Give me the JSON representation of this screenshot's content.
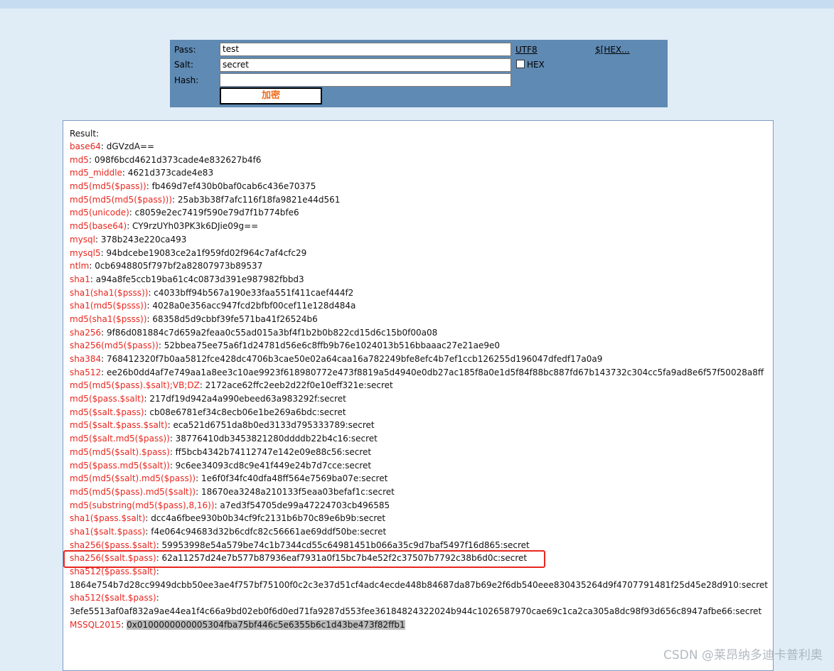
{
  "form": {
    "pass_label": "Pass:",
    "pass_value": "test",
    "salt_label": "Salt:",
    "salt_value": "secret",
    "hash_label": "Hash:",
    "hash_value": "",
    "utf8_link": "UTF8",
    "hex_link": "$[HEX...",
    "hex_checkbox_label": "HEX",
    "hex_checked": false,
    "encrypt_button": "加密"
  },
  "result": {
    "title": "Result:",
    "rows": [
      {
        "key": "base64",
        "value": "dGVzdA=="
      },
      {
        "key": "md5",
        "value": "098f6bcd4621d373cade4e832627b4f6"
      },
      {
        "key": "md5_middle",
        "value": "4621d373cade4e83"
      },
      {
        "key": "md5(md5($pass))",
        "value": "fb469d7ef430b0baf0cab6c436e70375"
      },
      {
        "key": "md5(md5(md5($pass)))",
        "value": "25ab3b38f7afc116f18fa9821e44d561"
      },
      {
        "key": "md5(unicode)",
        "value": "c8059e2ec7419f590e79d7f1b774bfe6"
      },
      {
        "key": "md5(base64)",
        "value": "CY9rzUYh03PK3k6DJie09g=="
      },
      {
        "key": "mysql",
        "value": "378b243e220ca493"
      },
      {
        "key": "mysql5",
        "value": "94bdcebe19083ce2a1f959fd02f964c7af4cfc29"
      },
      {
        "key": "ntlm",
        "value": "0cb6948805f797bf2a82807973b89537"
      },
      {
        "key": "sha1",
        "value": "a94a8fe5ccb19ba61c4c0873d391e987982fbbd3"
      },
      {
        "key": "sha1(sha1($psss))",
        "value": "c4033bff94b567a190e33faa551f411caef444f2"
      },
      {
        "key": "sha1(md5($psss))",
        "value": "4028a0e356acc947fcd2bfbf00cef11e128d484a"
      },
      {
        "key": "md5(sha1($psss))",
        "value": "68358d5d9cbbf39fe571ba41f26524b6"
      },
      {
        "key": "sha256",
        "value": "9f86d081884c7d659a2feaa0c55ad015a3bf4f1b2b0b822cd15d6c15b0f00a08"
      },
      {
        "key": "sha256(md5($pass))",
        "value": "52bbea75ee75a6f1d24781d56e6c8ffb9b76e1024013b516bbaaac27e21ae9e0"
      },
      {
        "key": "sha384",
        "value": "768412320f7b0aa5812fce428dc4706b3cae50e02a64caa16a782249bfe8efc4b7ef1ccb126255d196047dfedf17a0a9"
      },
      {
        "key": "sha512",
        "value": "ee26b0dd4af7e749aa1a8ee3c10ae9923f618980772e473f8819a5d4940e0db27ac185f8a0e1d5f84f88bc887fd67b143732c304cc5fa9ad8e6f57f50028a8ff"
      },
      {
        "key": "md5(md5($pass).$salt);VB;DZ",
        "value": "2172ace62ffc2eeb2d22f0e10eff321e:secret"
      },
      {
        "key": "md5($pass.$salt)",
        "value": "217df19d942a4a990ebeed63a983292f:secret"
      },
      {
        "key": "md5($salt.$pass)",
        "value": "cb08e6781ef34c8ecb06e1be269a6bdc:secret"
      },
      {
        "key": "md5($salt.$pass.$salt)",
        "value": "eca521d6751da8b0ed3133d795333789:secret"
      },
      {
        "key": "md5($salt.md5($pass))",
        "value": "38776410db3453821280ddddb22b4c16:secret"
      },
      {
        "key": "md5(md5($salt).$pass)",
        "value": "ff5bcb4342b74112747e142e09e88c56:secret"
      },
      {
        "key": "md5($pass.md5($salt))",
        "value": "9c6ee34093cd8c9e41f449e24b7d7cce:secret"
      },
      {
        "key": "md5(md5($salt).md5($pass))",
        "value": "1e6f0f34fc40dfa48ff564e7569ba07e:secret"
      },
      {
        "key": "md5(md5($pass).md5($salt))",
        "value": "18670ea3248a210133f5eaa03befaf1c:secret"
      },
      {
        "key": "md5(substring(md5($pass),8,16))",
        "value": "a7ed3f54705de99a47224703cb496585"
      },
      {
        "key": "sha1($pass.$salt)",
        "value": "dcc4a6fbee930b0b34cf9fc2131b6b70c89e6b9b:secret"
      },
      {
        "key": "sha1($salt.$pass)",
        "value": "f4e064c94683d32b6cdfc82c56661ae69ddf50be:secret"
      },
      {
        "key": "sha256($pass.$salt)",
        "value": "59953998e54a579be74c1b7344cd55c64981451b066a35c9d7baf5497f16d865:secret"
      },
      {
        "key": "sha256($salt.$pass)",
        "value": "62a11257d24e7b577b87936eaf7931a0f15bc7b4e52f2c37507b7792c38b6d0c:secret"
      },
      {
        "key": "sha512($pass.$salt)",
        "value": ""
      },
      {
        "key": "",
        "value": "1864e754b7d28cc9949dcbb50ee3ae4f757bf75100f0c2c3e37d51cf4adc4ecde448b84687da87b69e2f6db540eee830435264d9f4707791481f25d45e28d910:secret"
      },
      {
        "key": "sha512($salt.$pass)",
        "value": ""
      },
      {
        "key": "",
        "value": "3efe5513af0af832a9ae44ea1f4c66a9bd02eb0f6d0ed71fa9287d553fee36184824322024b944c1026587970cae69c1ca2ca305a8dc98f93d656c8947afbe66:secret"
      },
      {
        "key": "MSSQL2015",
        "value": "0x0100000000005304fba75bf446c5e6355b6c1d43be473f82ffb1"
      }
    ]
  },
  "watermark": "CSDN @莱昂纳多迪卡普利奥",
  "colors": {
    "page_bg": "#e1edf6",
    "form_bg": "#5f8ab3",
    "key_color": "#e8271f",
    "button_text": "#f06a1a",
    "highlight_border": "#e8271f"
  }
}
